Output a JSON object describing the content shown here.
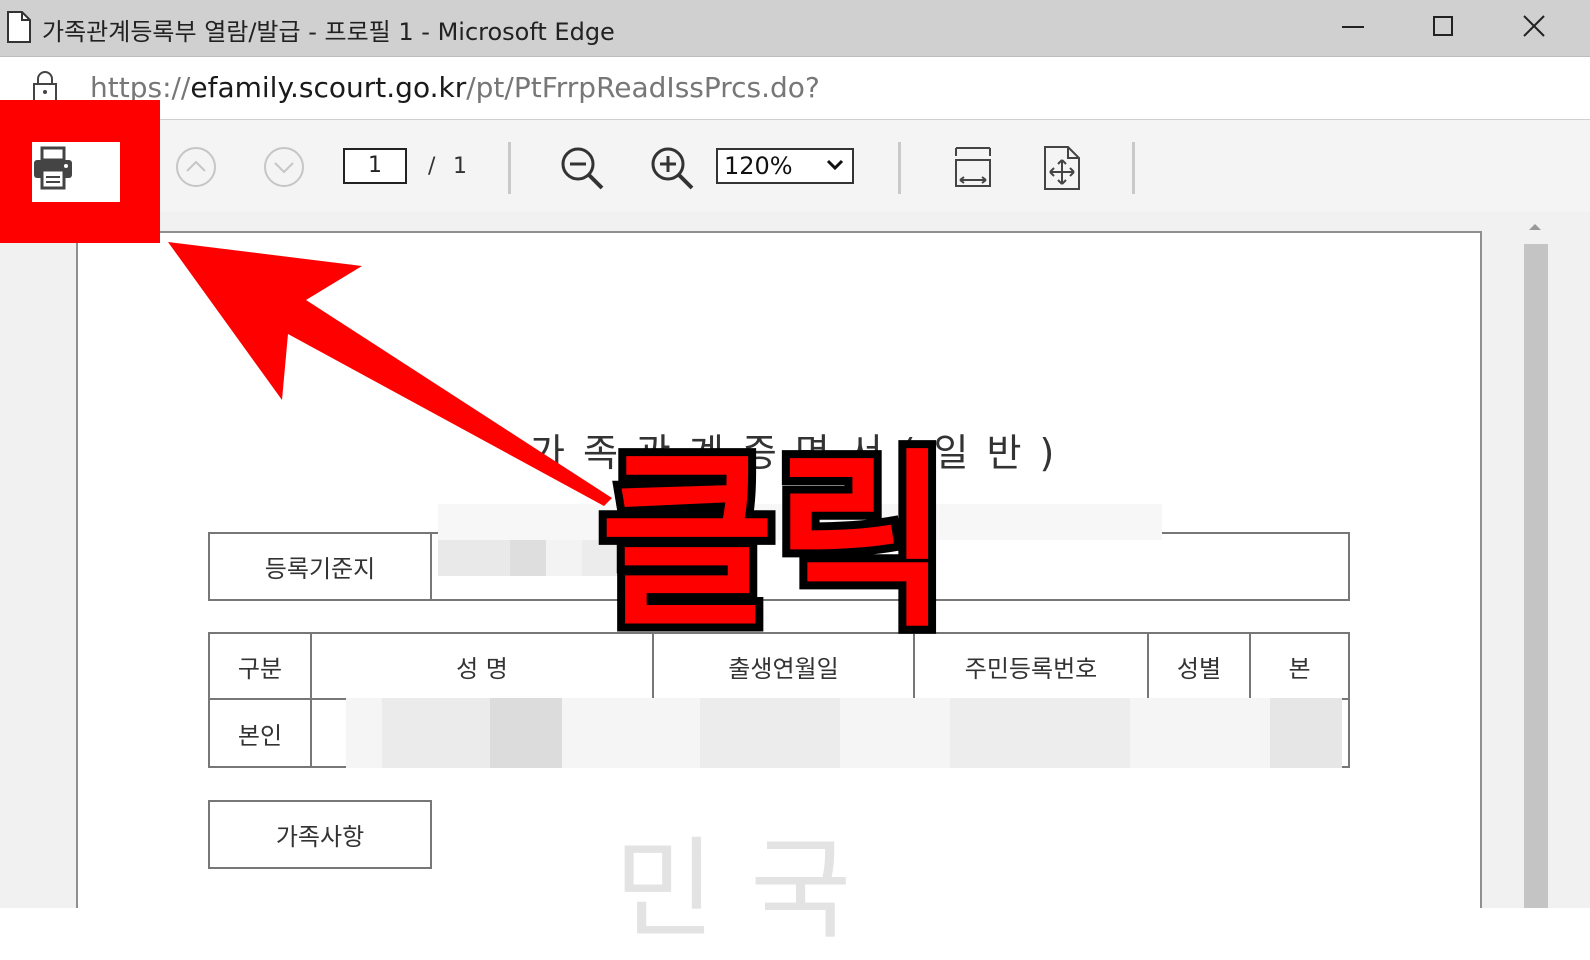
{
  "window": {
    "title": "가족관계등록부 열람/발급 - 프로필 1 - Microsoft Edge"
  },
  "address_bar": {
    "url_scheme": "https://",
    "url_host": "efamily.scourt.go.kr",
    "url_path": "/pt/PtFrrpReadIssPrcs.do?"
  },
  "pdf_toolbar": {
    "current_page": "1",
    "page_separator": "/",
    "total_pages": "1",
    "zoom_level": "120%"
  },
  "document": {
    "title": "가족관계증명서(일반)",
    "registration_label": "등록기준지",
    "headers": [
      "구분",
      "성 명",
      "출생연월일",
      "주민등록번호",
      "성별",
      "본"
    ],
    "row_label": "본인",
    "family_label": "가족사항",
    "watermark": "민 국"
  },
  "annotation": {
    "click_label": "클릭",
    "color": "#ff0000"
  },
  "icons": [
    "document-icon",
    "minimize-icon",
    "maximize-icon",
    "close-icon",
    "lock-icon",
    "printer-icon",
    "chevron-up-icon",
    "chevron-down-icon",
    "zoom-out-icon",
    "zoom-in-icon",
    "fit-width-icon",
    "fit-page-icon"
  ]
}
